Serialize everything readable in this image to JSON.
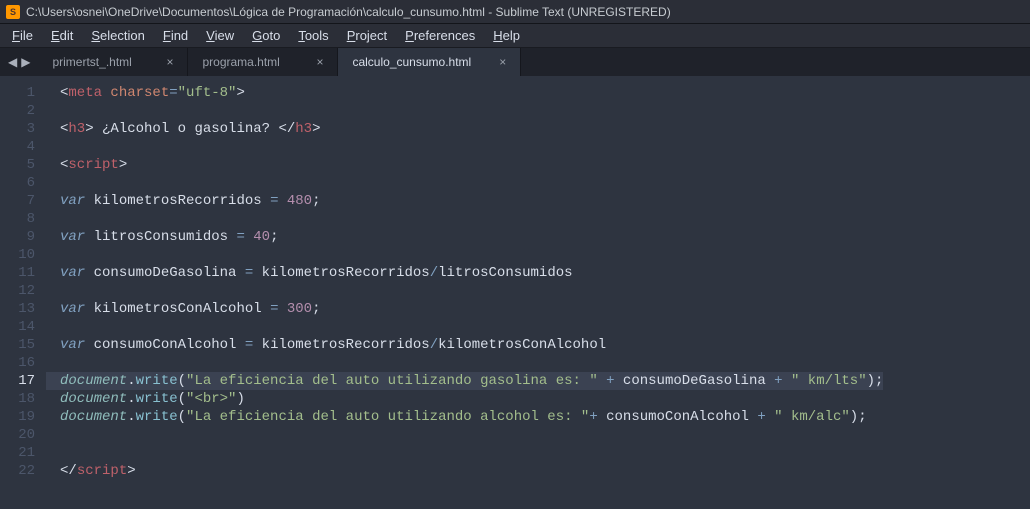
{
  "title_bar": {
    "text": "C:\\Users\\osnei\\OneDrive\\Documentos\\Lógica de Programación\\calculo_cunsumo.html - Sublime Text (UNREGISTERED)",
    "app_icon_glyph": "S"
  },
  "menu": {
    "items": [
      "File",
      "Edit",
      "Selection",
      "Find",
      "View",
      "Goto",
      "Tools",
      "Project",
      "Preferences",
      "Help"
    ]
  },
  "nav": {
    "back": "◀",
    "forward": "▶"
  },
  "tabs": [
    {
      "label": "primertst_.html",
      "active": false,
      "close": "×"
    },
    {
      "label": "programa.html",
      "active": false,
      "close": "×"
    },
    {
      "label": "calculo_cunsumo.html",
      "active": true,
      "close": "×"
    }
  ],
  "gutter": {
    "lines": [
      "1",
      "2",
      "3",
      "4",
      "5",
      "6",
      "7",
      "8",
      "9",
      "10",
      "11",
      "12",
      "13",
      "14",
      "15",
      "16",
      "17",
      "18",
      "19",
      "20",
      "21",
      "22"
    ],
    "current": 17
  },
  "code": {
    "lines": [
      [
        [
          "<",
          "punct"
        ],
        [
          "meta",
          "tag"
        ],
        [
          " ",
          "punct"
        ],
        [
          "charset",
          "attr"
        ],
        [
          "=",
          "op"
        ],
        [
          "\"uft-8\"",
          "string"
        ],
        [
          ">",
          "punct"
        ]
      ],
      [],
      [
        [
          "<",
          "punct"
        ],
        [
          "h3",
          "tag"
        ],
        [
          ">",
          "punct"
        ],
        [
          " ¿Alcohol o gasolina? ",
          "ident"
        ],
        [
          "<",
          "punct"
        ],
        [
          "/",
          "punct"
        ],
        [
          "h3",
          "tag"
        ],
        [
          ">",
          "punct"
        ]
      ],
      [],
      [
        [
          "<",
          "punct"
        ],
        [
          "script",
          "tag"
        ],
        [
          ">",
          "punct"
        ]
      ],
      [],
      [
        [
          "var",
          "keyword"
        ],
        [
          " kilometrosRecorridos ",
          "ident"
        ],
        [
          "=",
          "op"
        ],
        [
          " ",
          "ident"
        ],
        [
          "480",
          "num"
        ],
        [
          ";",
          "punct"
        ]
      ],
      [],
      [
        [
          "var",
          "keyword"
        ],
        [
          " litrosConsumidos ",
          "ident"
        ],
        [
          "=",
          "op"
        ],
        [
          " ",
          "ident"
        ],
        [
          "40",
          "num"
        ],
        [
          ";",
          "punct"
        ]
      ],
      [],
      [
        [
          "var",
          "keyword"
        ],
        [
          " consumoDeGasolina ",
          "ident"
        ],
        [
          "=",
          "op"
        ],
        [
          " kilometrosRecorridos",
          "ident"
        ],
        [
          "/",
          "op"
        ],
        [
          "litrosConsumidos",
          "ident"
        ]
      ],
      [],
      [
        [
          "var",
          "keyword"
        ],
        [
          " kilometrosConAlcohol ",
          "ident"
        ],
        [
          "=",
          "op"
        ],
        [
          " ",
          "ident"
        ],
        [
          "300",
          "num"
        ],
        [
          ";",
          "punct"
        ]
      ],
      [],
      [
        [
          "var",
          "keyword"
        ],
        [
          " consumoConAlcohol ",
          "ident"
        ],
        [
          "=",
          "op"
        ],
        [
          " kilometrosRecorridos",
          "ident"
        ],
        [
          "/",
          "op"
        ],
        [
          "kilometrosConAlcohol",
          "ident"
        ]
      ],
      [],
      [
        [
          "document",
          "obj"
        ],
        [
          ".",
          "punct"
        ],
        [
          "write",
          "func"
        ],
        [
          "(",
          "punct"
        ],
        [
          "\"La eficiencia del auto utilizando gasolina es: \"",
          "string"
        ],
        [
          " ",
          "ident"
        ],
        [
          "+",
          "op"
        ],
        [
          " consumoDeGasolina ",
          "ident"
        ],
        [
          "+",
          "op"
        ],
        [
          " ",
          "ident"
        ],
        [
          "\" km/lts\"",
          "string"
        ],
        [
          ")",
          "punct"
        ],
        [
          ";",
          "punct"
        ]
      ],
      [
        [
          "document",
          "obj"
        ],
        [
          ".",
          "punct"
        ],
        [
          "write",
          "func"
        ],
        [
          "(",
          "punct"
        ],
        [
          "\"<br>\"",
          "string"
        ],
        [
          ")",
          "punct"
        ]
      ],
      [
        [
          "document",
          "obj"
        ],
        [
          ".",
          "punct"
        ],
        [
          "write",
          "func"
        ],
        [
          "(",
          "punct"
        ],
        [
          "\"La eficiencia del auto utilizando alcohol es: \"",
          "string"
        ],
        [
          "+",
          "op"
        ],
        [
          " consumoConAlcohol ",
          "ident"
        ],
        [
          "+",
          "op"
        ],
        [
          " ",
          "ident"
        ],
        [
          "\" km/alc\"",
          "string"
        ],
        [
          ")",
          "punct"
        ],
        [
          ";",
          "punct"
        ]
      ],
      [],
      [],
      [
        [
          "<",
          "punct"
        ],
        [
          "/",
          "punct"
        ],
        [
          "script",
          "tag"
        ],
        [
          ">",
          "punct"
        ]
      ]
    ]
  }
}
